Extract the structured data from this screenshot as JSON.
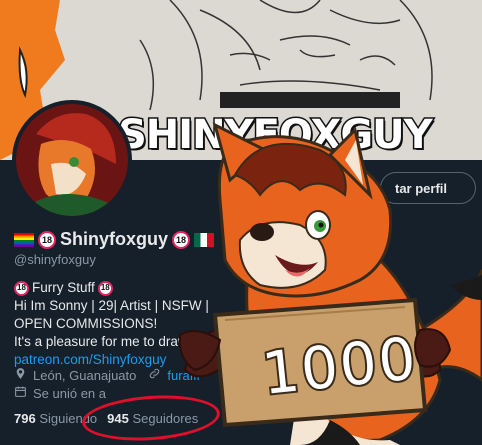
{
  "banner": {
    "brand_text": "SHINYFOXGUY"
  },
  "profile": {
    "edit_button_label": "tar perfil",
    "display_name": "Shinyfoxguy",
    "badge": "18",
    "handle": "@shinyfoxguy",
    "bio_lines": [
      "Furry Stuff",
      "Hi Im Sonny | 29| Artist | NSFW |",
      "OPEN COMMISSIONS!",
      "It's a pleasure for me to draw yo"
    ],
    "bio_link": "patreon.com/Shinyfoxguy",
    "location": "León, Guanajuato",
    "website": "furaffi",
    "joined": "Se unió en a",
    "following_count": "796",
    "following_label": "Siguiendo",
    "followers_count": "945",
    "followers_label": "Seguidores"
  },
  "overlay": {
    "sign_text": "1000"
  },
  "colors": {
    "accent": "#1d9bf0",
    "background": "#15202b",
    "highlight_circle": "#e0102a",
    "fox_orange": "#e8641e"
  },
  "icons": [
    "rainbow-flag-icon",
    "mexico-flag-icon",
    "adult-badge-icon",
    "location-icon",
    "link-icon",
    "calendar-icon"
  ]
}
